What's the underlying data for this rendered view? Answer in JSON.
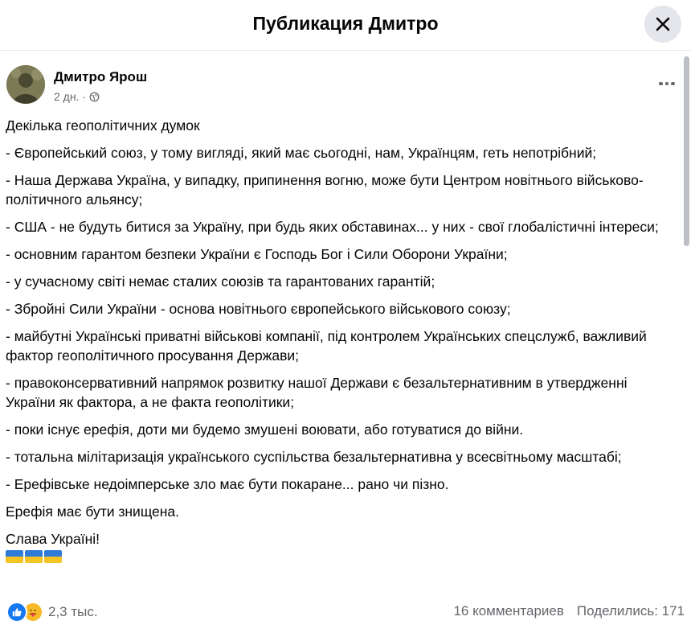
{
  "header": {
    "title": "Публикация Дмитро"
  },
  "post": {
    "author": "Дмитро Ярош",
    "time": "2 дн.",
    "separator": "·",
    "paragraphs": [
      "Декілька геополітичних думок",
      "- Європейський союз, у тому вигляді, який має сьогодні, нам, Українцям, геть непотрібний;",
      "- Наша Держава Україна, у випадку, припинення вогню, може бути Центром новітнього військово-політичного альянсу;",
      "- США - не будуть битися за Україну, при будь яких обставинах... у них - свої глобалістичні інтереси;",
      "- основним гарантом безпеки України є Господь Бог і Сили Оборони України;",
      "- у сучасному світі немає сталих союзів та гарантованих гарантій;",
      "- Збройні Сили України - основа новітнього європейського військового союзу;",
      "- майбутні Українські приватні військові компанії, під контролем Українських спецслужб, важливий фактор геополітичного просування Держави;",
      "- правоконсервативний напрямок розвитку нашої Держави є безальтернативним в утвердженні України як фактора, а не факта геополітики;",
      "- поки існує ерефія, доти ми будемо змушені воювати, або готуватися до війни.",
      "- тотальна мілітаризація українського суспільства безальтернативна у всесвітньому масштабі;",
      "- Ерефівське недоімперське зло має бути покаране... рано чи пізно.",
      "Ерефія має бути знищена.",
      "Слава Україні!"
    ],
    "flag_count": 3
  },
  "footer": {
    "reactions": [
      "like-icon",
      "care-icon"
    ],
    "reaction_count": "2,3 тыс.",
    "comments": "16 комментариев",
    "shares": "Поделились: 171"
  },
  "colors": {
    "accent": "#1877f2",
    "secondary_text": "#65676b",
    "flag_blue": "#2f7bd8",
    "flag_yellow": "#f6c324"
  }
}
